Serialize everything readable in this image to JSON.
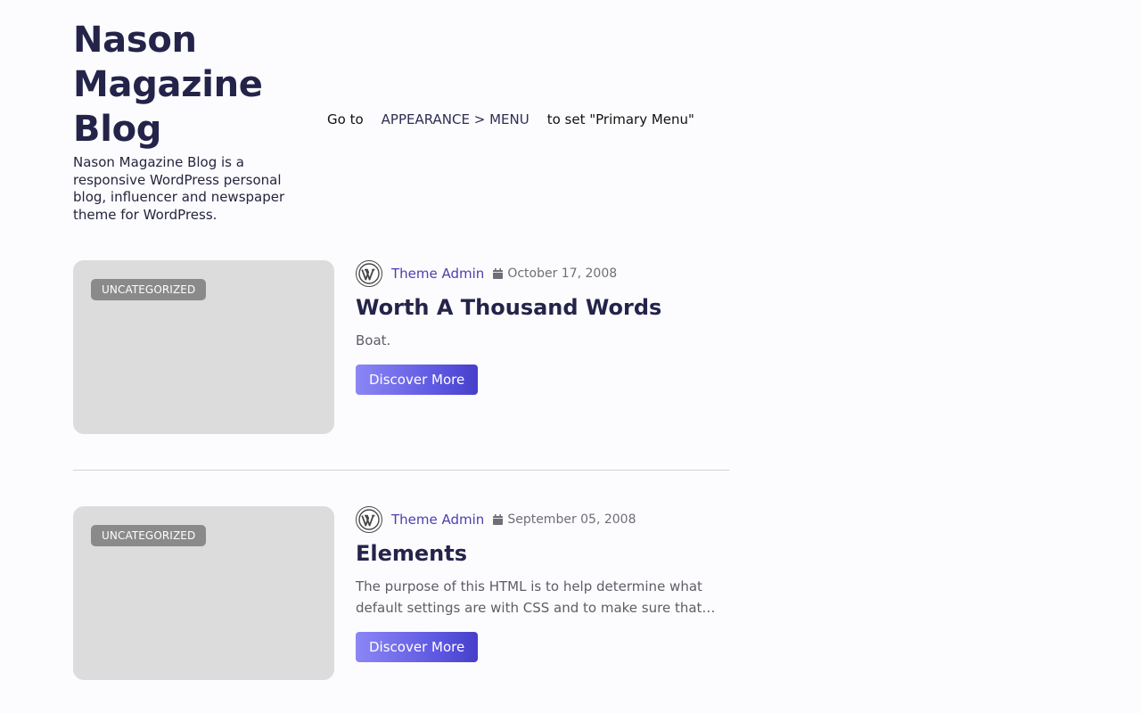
{
  "site": {
    "title": "Nason Magazine Blog",
    "description": "Nason Magazine Blog is a responsive WordPress personal blog, influencer and newspaper theme for WordPress."
  },
  "menu_hint": {
    "prefix": "Go to",
    "path": "APPEARANCE > MENU",
    "suffix": "to set \"Primary Menu\""
  },
  "posts": [
    {
      "category": "UNCATEGORIZED",
      "author": "Theme Admin",
      "date": "October 17, 2008",
      "title": "Worth A Thousand Words",
      "excerpt": "Boat.",
      "button": "Discover More"
    },
    {
      "category": "UNCATEGORIZED",
      "author": "Theme Admin",
      "date": "September 05, 2008",
      "title": "Elements",
      "excerpt": "The purpose of this HTML is to help determine what default settings are with CSS and to make sure that…",
      "button": "Discover More"
    }
  ],
  "icons": {
    "avatar": "wordpress-logo-icon",
    "date": "calendar-icon"
  },
  "colors": {
    "accent": "#4b3fae",
    "button_start": "#8b87f5",
    "button_end": "#463fc8",
    "badge": "#8a8a8a",
    "thumb": "#dcdcdc"
  }
}
